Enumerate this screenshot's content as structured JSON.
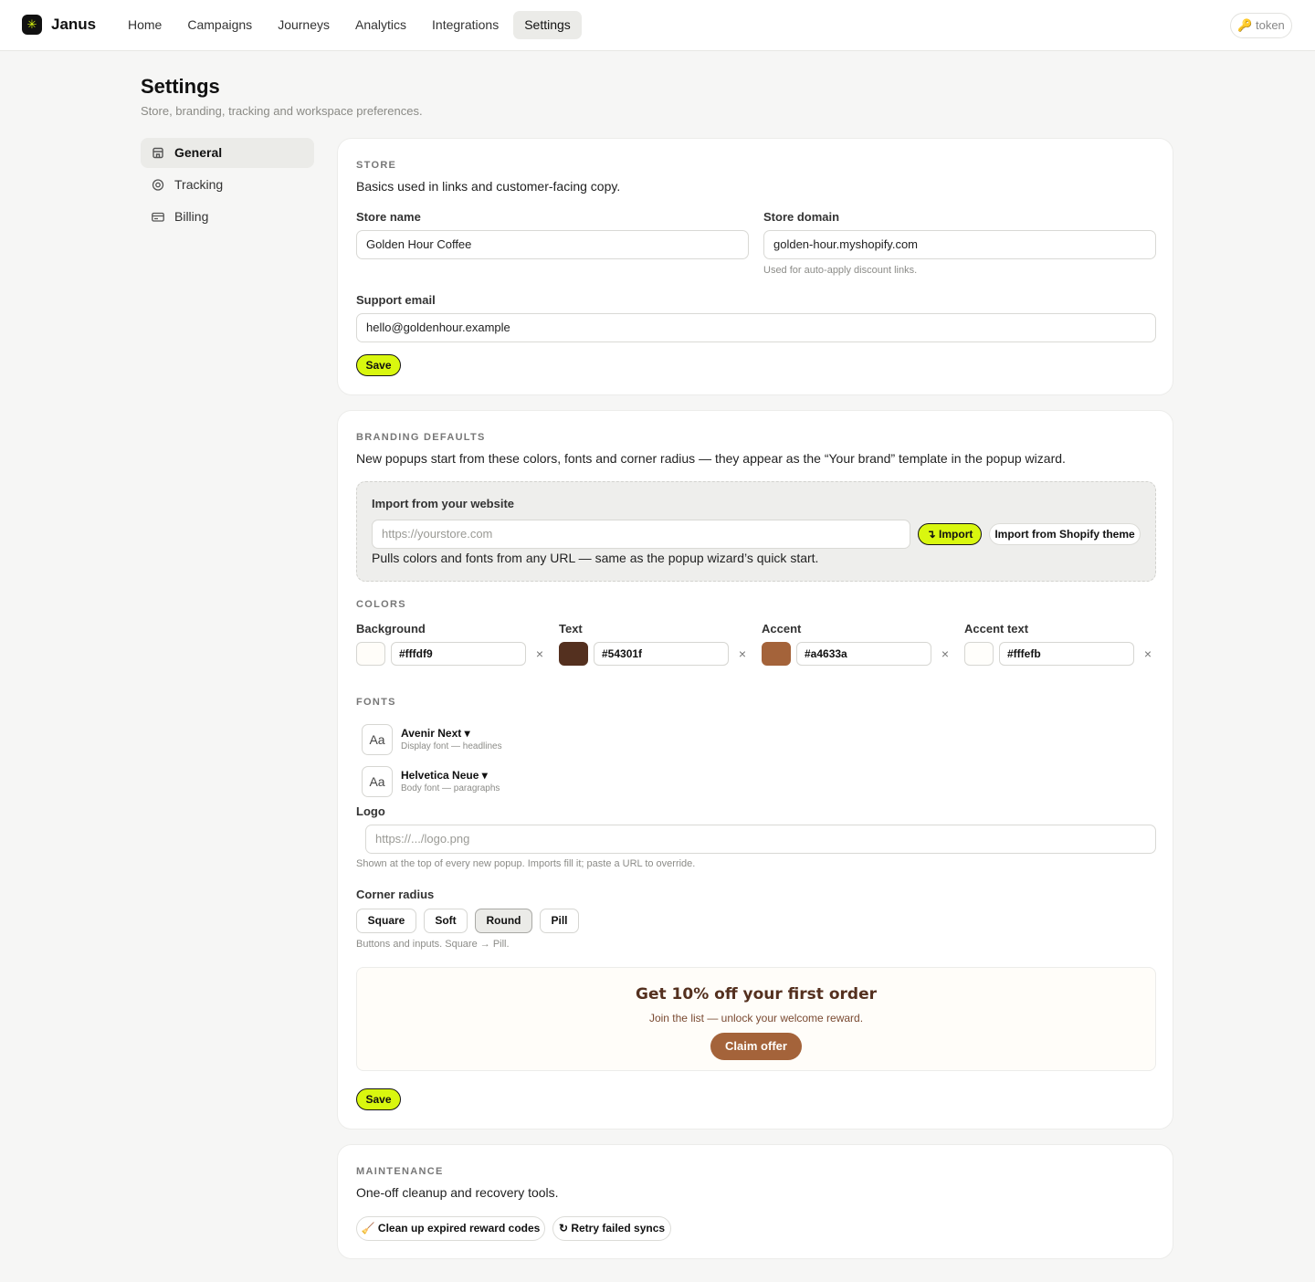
{
  "app": {
    "name": "Janus",
    "logo_glyph": "✳",
    "token_label": "🔑 token"
  },
  "nav": {
    "items": [
      "Home",
      "Campaigns",
      "Journeys",
      "Analytics",
      "Integrations",
      "Settings"
    ],
    "active": "Settings"
  },
  "page": {
    "title": "Settings",
    "subtitle": "Store, branding, tracking and workspace preferences."
  },
  "sidebar": {
    "items": [
      {
        "label": "General",
        "icon": "storefront-icon"
      },
      {
        "label": "Tracking",
        "icon": "target-icon"
      },
      {
        "label": "Billing",
        "icon": "credit-card-icon"
      }
    ],
    "active": "General"
  },
  "store": {
    "section_label": "STORE",
    "description": "Basics used in links and customer-facing copy.",
    "name_label": "Store name",
    "name_value": "Golden Hour Coffee",
    "domain_label": "Store domain",
    "domain_value": "golden-hour.myshopify.com",
    "domain_hint": "Used for auto-apply discount links.",
    "email_label": "Support email",
    "email_value": "hello@goldenhour.example",
    "save_label": "Save"
  },
  "branding": {
    "section_label": "BRANDING DEFAULTS",
    "description": "New popups start from these colors, fonts and corner radius — they appear as the “Your brand” template in the popup wizard.",
    "import": {
      "title": "Import from your website",
      "placeholder": "https://yourstore.com",
      "import_label": "↴ Import",
      "shopify_label": "Import from Shopify theme",
      "hint": "Pulls colors and fonts from any URL — same as the popup wizard’s quick start."
    },
    "colors_label": "COLORS",
    "colors": [
      {
        "label": "Background",
        "value": "#fffdf9"
      },
      {
        "label": "Text",
        "value": "#54301f"
      },
      {
        "label": "Accent",
        "value": "#a4633a"
      },
      {
        "label": "Accent text",
        "value": "#fffefb"
      }
    ],
    "fonts_label": "FONTS",
    "fonts": [
      {
        "sample": "Aa",
        "name": "Avenir Next ▾",
        "desc": "Display font — headlines"
      },
      {
        "sample": "Aa",
        "name": "Helvetica Neue ▾",
        "desc": "Body font — paragraphs"
      }
    ],
    "logo_label": "Logo",
    "logo_placeholder": "https://.../logo.png",
    "logo_hint": "Shown at the top of every new popup. Imports fill it; paste a URL to override.",
    "radius_label": "Corner radius",
    "radius_options": [
      "Square",
      "Soft",
      "Round",
      "Pill"
    ],
    "radius_selected": "Round",
    "radius_hint": "Buttons and inputs. Square → Pill.",
    "preview": {
      "headline": "Get 10% off your first order",
      "body": "Join the list — unlock your welcome reward.",
      "cta": "Claim offer"
    },
    "save_label": "Save"
  },
  "maintenance": {
    "section_label": "MAINTENANCE",
    "description": "One-off cleanup and recovery tools.",
    "cleanup_label": "🧹 Clean up expired reward codes",
    "retry_label": "↻ Retry failed syncs"
  },
  "colors": {
    "accent": "#d9f70f",
    "preview_text": "#54301f",
    "preview_accent": "#a4633a"
  }
}
